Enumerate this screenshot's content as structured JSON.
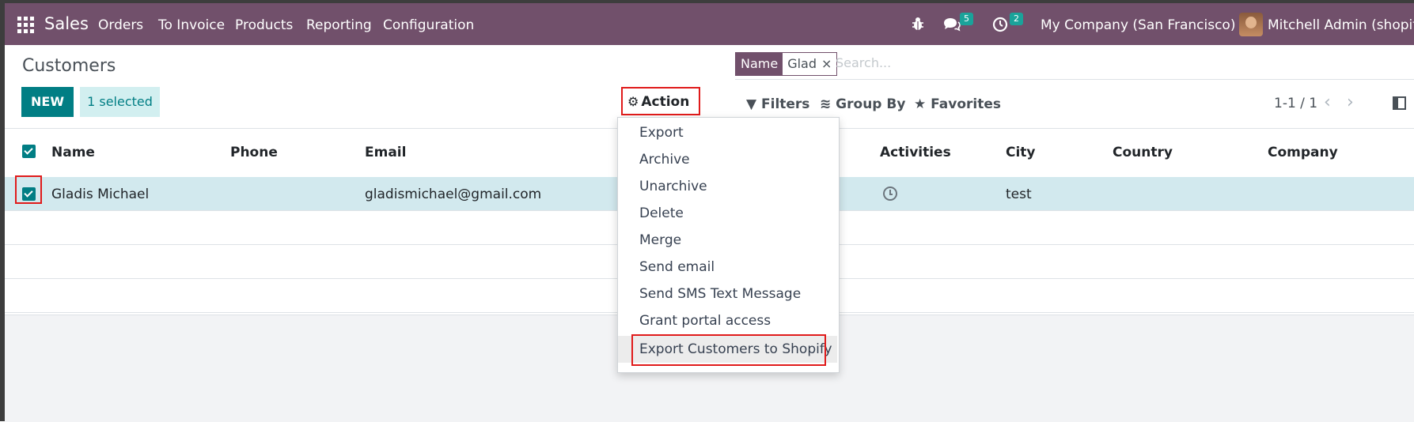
{
  "navbar": {
    "brand": "Sales",
    "menu": [
      "Orders",
      "To Invoice",
      "Products",
      "Reporting",
      "Configuration"
    ],
    "messages_count": "5",
    "activities_count": "2",
    "company": "My Company (San Francisco)",
    "user": "Mitchell Admin (shopify_"
  },
  "page": {
    "title": "Customers",
    "new_label": "NEW",
    "selected_label": "1 selected",
    "action_label": "Action"
  },
  "search": {
    "facet_name": "Name",
    "facet_value": "Glad",
    "placeholder": "Search..."
  },
  "controls": {
    "filters": "Filters",
    "group_by": "Group By",
    "favorites": "Favorites",
    "pager": "1-1 / 1"
  },
  "table": {
    "columns": [
      "Name",
      "Phone",
      "Email",
      "Activities",
      "City",
      "Country",
      "Company"
    ],
    "rows": [
      {
        "name": "Gladis Michael",
        "phone": "",
        "email": "gladismichael@gmail.com",
        "city": "test",
        "country": "",
        "company": ""
      }
    ]
  },
  "action_menu": {
    "items": [
      "Export",
      "Archive",
      "Unarchive",
      "Delete",
      "Merge",
      "Send email",
      "Send SMS Text Message",
      "Grant portal access",
      "Export Customers to Shopify"
    ]
  },
  "colors": {
    "navbar": "#71506b",
    "primary": "#017e84",
    "highlight_box": "#e01b1b",
    "selected_row": "#d2e9ee"
  }
}
